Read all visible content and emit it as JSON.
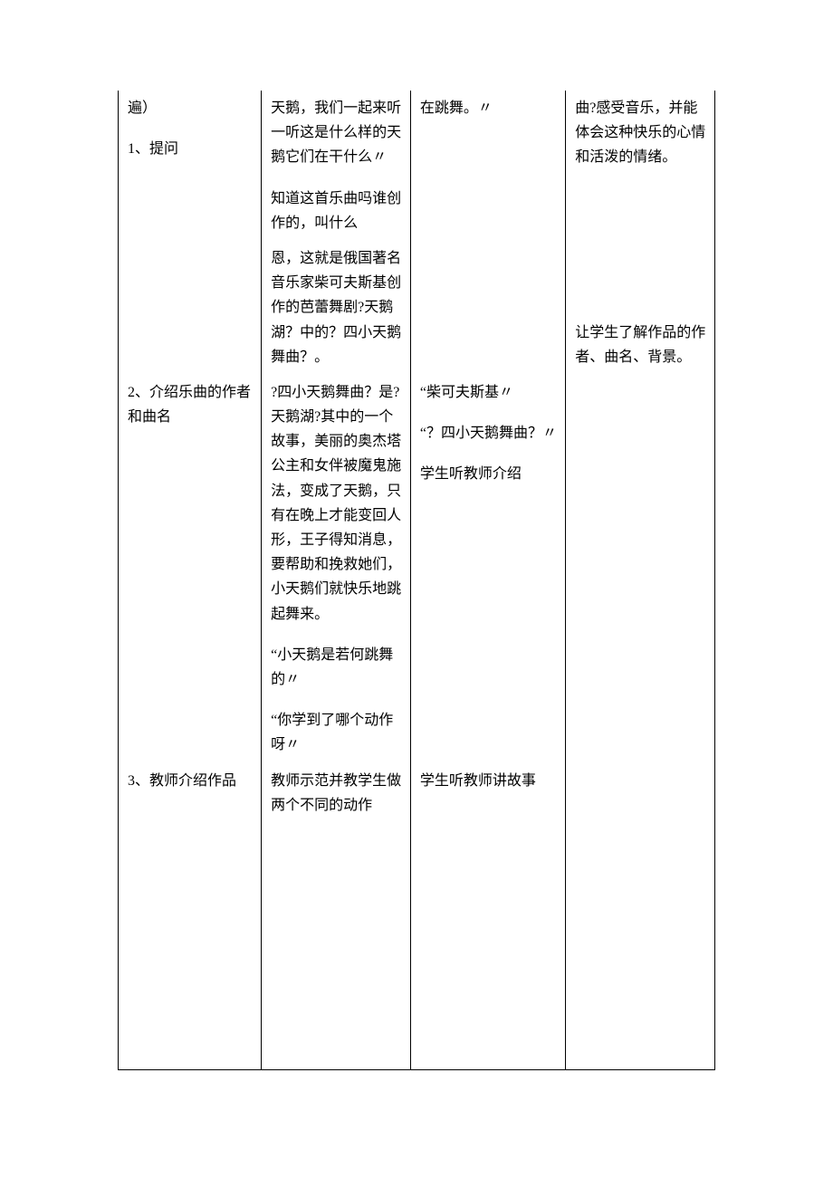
{
  "col1": {
    "p1": "遍）",
    "p2": "1、提问",
    "p3": "2、介绍乐曲的作者和曲名",
    "p4": "3、教师介绍作品"
  },
  "col2": {
    "p1": "天鹅，我们一起来听一听这是什么样的天鹅它们在干什么〃",
    "p2": "知道这首乐曲吗谁创作的，叫什么",
    "p3": "恩，这就是俄国著名音乐家柴可夫斯基创作的芭蕾舞剧?天鹅湖？中的？四小天鹅舞曲？。",
    "p4": "?四小天鹅舞曲？是?天鹅湖?其中的一个故事，美丽的奥杰塔公主和女伴被魔鬼施法，变成了天鹅，只有在晚上才能变回人形，王子得知消息，要帮助和挽救她们，小天鹅们就快乐地跳起舞来。",
    "p5": "“小天鹅是若何跳舞的〃",
    "p6": "“你学到了哪个动作呀〃",
    "p7": "教师示范并教学生做两个不同的动作"
  },
  "col3": {
    "p1": "在跳舞。〃",
    "p2": "“柴可夫斯基〃",
    "p3": "“？四小天鹅舞曲？〃",
    "p4": "学生听教师介绍",
    "p5": "学生听教师讲故事"
  },
  "col4": {
    "p1": "曲?感受音乐，并能体会这种快乐的心情和活泼的情绪。",
    "p2": "让学生了解作品的作者、曲名、背景。"
  }
}
